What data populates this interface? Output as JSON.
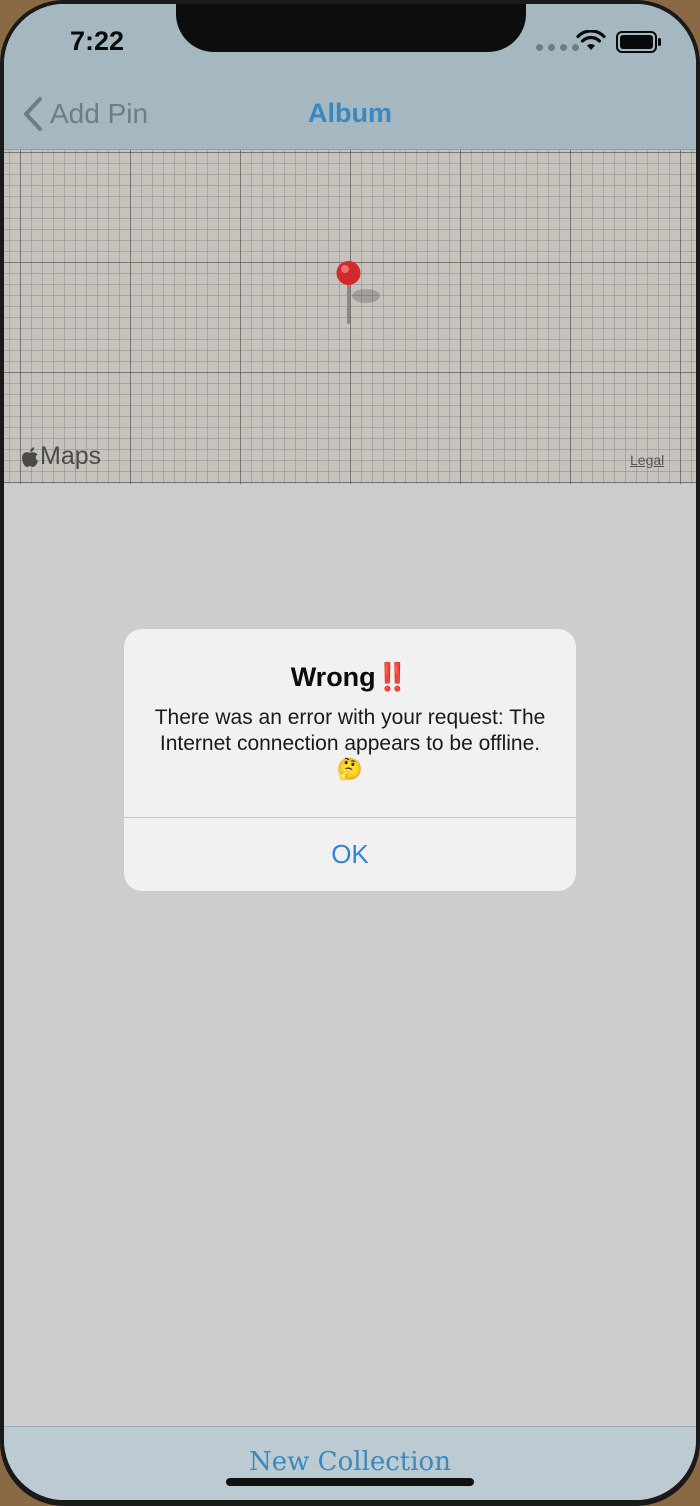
{
  "status_bar": {
    "time": "7:22",
    "icons": [
      "signal-dots-icon",
      "wifi-icon",
      "battery-icon"
    ]
  },
  "nav_bar": {
    "back_label": "Add Pin",
    "title": "Album"
  },
  "map": {
    "attribution_logo": "Maps",
    "legal_label": "Legal"
  },
  "alert": {
    "title": "Wrong‼️",
    "message": "There was an error with your request: The Internet connection appears to be offline. 🤔",
    "ok_label": "OK"
  },
  "toolbar": {
    "new_collection_label": "New Collection"
  },
  "colors": {
    "nav_background": "#a5b8c1",
    "accent_blue": "#3a88c0",
    "alert_button_blue": "#2f86d8",
    "pin_red": "#d22a2a",
    "screen_background": "#cdcdcd"
  }
}
